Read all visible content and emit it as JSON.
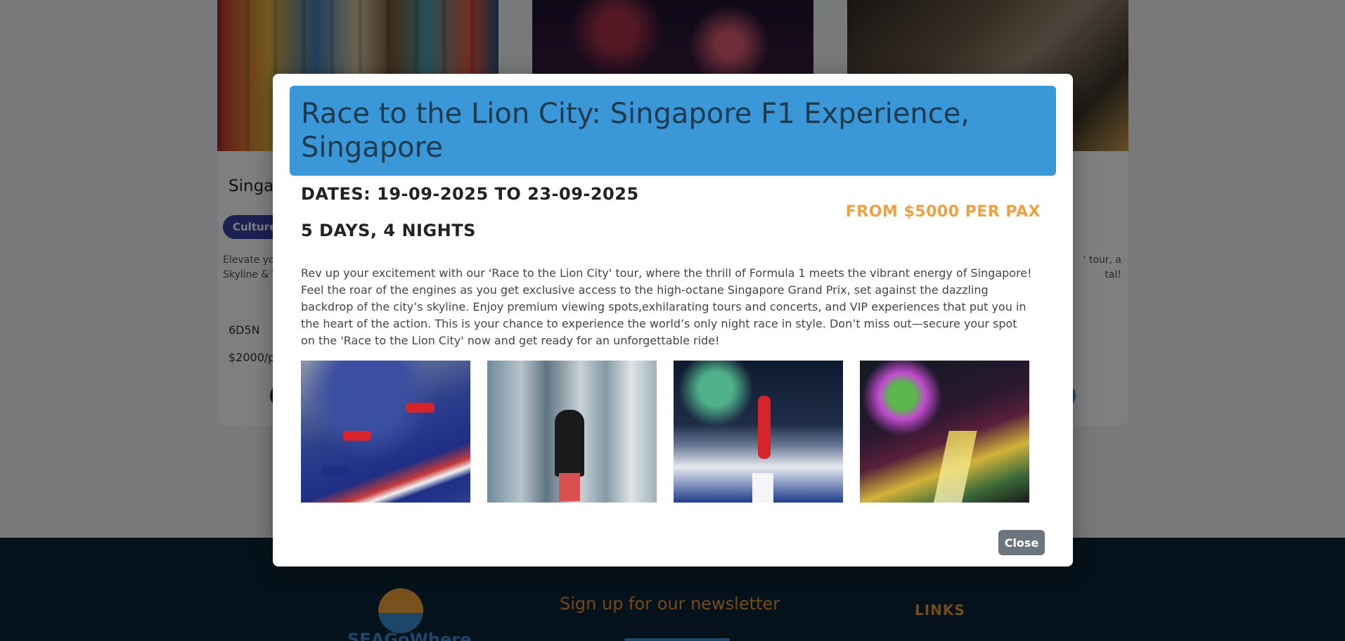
{
  "background": {
    "cards": [
      {
        "title": "Singap",
        "tag": "Culture",
        "desc": "Elevate you\nSkyline & T",
        "duration": "6D5N",
        "price": "$2000/p"
      },
      {
        "title": "",
        "tag": "",
        "desc": "",
        "duration": "",
        "price": ""
      },
      {
        "title": "",
        "tag": "",
        "desc": "' tour, a\ntal!",
        "duration": "",
        "price": ""
      }
    ],
    "footer": {
      "brand": "SEAGoWhere",
      "newsletter_heading": "Sign up for our newsletter",
      "links_heading": "LINKS"
    }
  },
  "modal": {
    "title": "Race to the Lion City: Singapore F1 Experience, Singapore",
    "dates": "DATES: 19-09-2025 TO 23-09-2025",
    "duration": "5 DAYS, 4 NIGHTS",
    "price": "FROM $5000 PER PAX",
    "description": "Rev up your excitement with our 'Race to the Lion City' tour, where the thrill of Formula 1 meets the vibrant energy of Singapore! Feel the roar of the engines as you get exclusive access to the high-octane Singapore Grand Prix, set against the dazzling backdrop of the city’s skyline. Enjoy premium viewing spots,exhilarating tours and concerts, and VIP experiences that put you in the heart of the action. This is your chance to experience the world’s only night race in style. Don’t miss out—secure your spot on the 'Race to the Lion City' now and get ready for an unforgettable ride!",
    "close_label": "Close",
    "colors": {
      "header_bg": "#3a98d8",
      "price": "#f0a040",
      "close_bg": "#6c757d"
    }
  }
}
